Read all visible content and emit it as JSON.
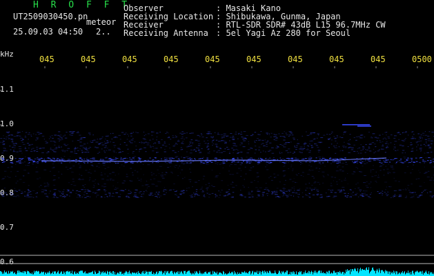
{
  "header": {
    "program": "H R O F F T",
    "filename": "UT2509030450.pn",
    "meteor_label": "meteor",
    "datetime": "25.09.03 04:50",
    "count": "2..",
    "info": [
      {
        "label": "Observer",
        "value": ": Masaki Kano"
      },
      {
        "label": "Receiving Location",
        "value": ": Shibukawa, Gunma, Japan"
      },
      {
        "label": "Receiver",
        "value": ": RTL-SDR SDR# 43dB L15 96.7MHz CW"
      },
      {
        "label": "Receiving Antenna",
        "value": ": 5el Yagi Az 280 for Seoul"
      }
    ]
  },
  "axis": {
    "unit": "kHz",
    "time_labels": [
      "045",
      "045",
      "045",
      "045",
      "045",
      "045",
      "045",
      "045",
      "045",
      "0500"
    ],
    "freq_labels": [
      "1.1",
      "1.0",
      "0.9",
      "0.8",
      "0.7",
      "0.6"
    ]
  },
  "colors": {
    "background": "#000000",
    "text": "#e8e8e8",
    "title": "#27e04a",
    "time_labels": "#f0e040",
    "signal": "#3a4cff",
    "noise": "#00e5ff"
  }
}
